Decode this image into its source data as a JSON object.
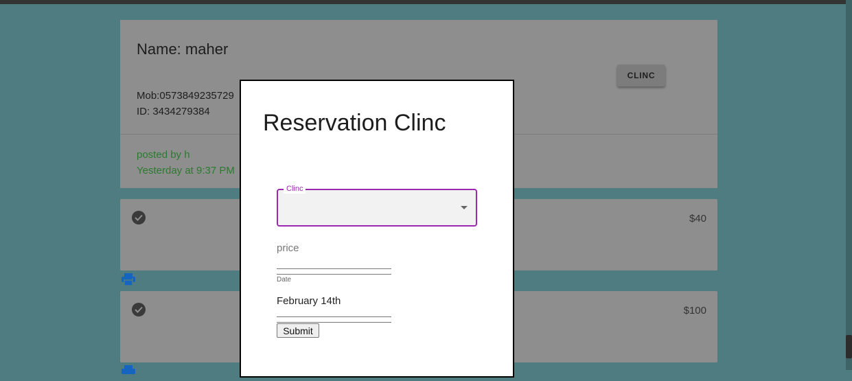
{
  "profile": {
    "name": "Name: maher",
    "mob": "Mob:0573849235729",
    "id": "ID: 3434279384",
    "posted_by": "posted by h",
    "posted_time": "Yesterday at 9:37 PM",
    "clinc_button": "CLINC"
  },
  "items": [
    {
      "price": "$40",
      "icon": "check-circle-icon"
    },
    {
      "price": "$100",
      "icon": "check-circle-icon"
    }
  ],
  "modal": {
    "title": "Reservation Clinc",
    "clinc_select": {
      "label": "Clinc",
      "value": ""
    },
    "price_field": {
      "label": "price",
      "value": ""
    },
    "date_field": {
      "label": "Date",
      "value": "February 14th"
    },
    "submit_label": "Submit"
  },
  "colors": {
    "backdrop": "#4e7c80",
    "accent": "#9c27b0",
    "posted_text": "#2c7a2f",
    "print_icon": "#1565c0"
  }
}
